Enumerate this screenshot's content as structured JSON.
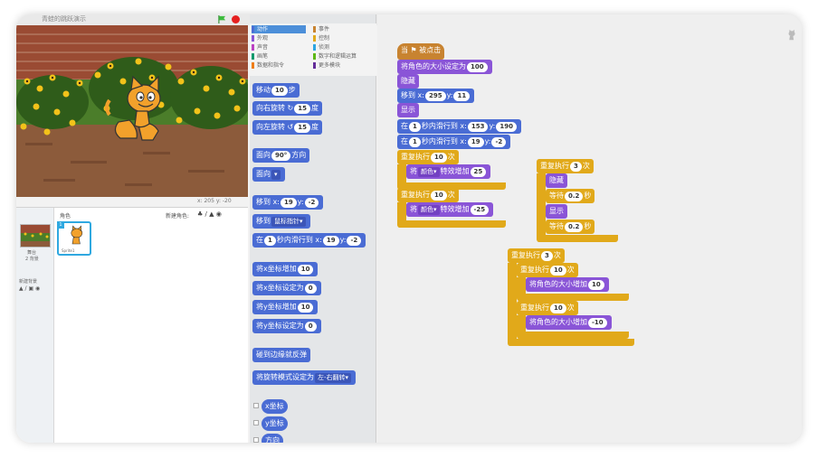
{
  "window": {
    "title": "青蛙的跳跃演示"
  },
  "stage": {
    "coords": "x: 205  y: -20"
  },
  "sprites": {
    "header": "角色",
    "new_sprite_label": "新建角色:",
    "stage_label": "舞台",
    "stage_count": "2 背景",
    "new_backdrop_label": "新建背景",
    "list": [
      {
        "index": "1",
        "name": "Sprite1"
      }
    ]
  },
  "categories": [
    {
      "label": "动作",
      "color": "#4a6cd4",
      "selected": true
    },
    {
      "label": "外观",
      "color": "#8a55d7"
    },
    {
      "label": "声音",
      "color": "#bb42c3"
    },
    {
      "label": "画笔",
      "color": "#0e9a6c"
    },
    {
      "label": "数据和指令",
      "color": "#ee7d16"
    },
    {
      "label": "事件",
      "color": "#c88330"
    },
    {
      "label": "控制",
      "color": "#e1a91a"
    },
    {
      "label": "侦测",
      "color": "#2ca5e2"
    },
    {
      "label": "数字和逻辑运算",
      "color": "#5cb712"
    },
    {
      "label": "更多模块",
      "color": "#632d99"
    }
  ],
  "palette": {
    "move": {
      "pre": "移动",
      "v": "10",
      "post": "步"
    },
    "turn_right": {
      "pre": "向右旋转",
      "icon": "↻",
      "v": "15",
      "post": "度"
    },
    "turn_left": {
      "pre": "向左旋转",
      "icon": "↺",
      "v": "15",
      "post": "度"
    },
    "point_dir": {
      "pre": "面向",
      "v": "90°",
      "post": "方向"
    },
    "point_towards": {
      "pre": "面向",
      "v": "▾"
    },
    "goto_xy": {
      "pre": "移到 x:",
      "x": "19",
      "mid": "y:",
      "y": "-2"
    },
    "goto_target": {
      "pre": "移到",
      "v": "鼠标指针▾"
    },
    "glide": {
      "pre": "在",
      "secs": "1",
      "mid": "秒内滑行到 x:",
      "x": "19",
      "mid2": "y:",
      "y": "-2"
    },
    "change_x": {
      "pre": "将x坐标增加",
      "v": "10"
    },
    "set_x": {
      "pre": "将x坐标设定为",
      "v": "0"
    },
    "change_y": {
      "pre": "将y坐标增加",
      "v": "10"
    },
    "set_y": {
      "pre": "将y坐标设定为",
      "v": "0"
    },
    "bounce": {
      "label": "碰到边缘就反弹"
    },
    "rotation_style": {
      "pre": "将旋转模式设定为",
      "v": "左-右翻转▾"
    },
    "reporters": [
      "x坐标",
      "y坐标",
      "方向"
    ]
  },
  "script": {
    "hat": "当 ⚑ 被点击",
    "set_size": {
      "pre": "将角色的大小设定为",
      "v": "100"
    },
    "hide": "隐藏",
    "goto": {
      "pre": "移到 x:",
      "x": "295",
      "mid": "y:",
      "y": "11"
    },
    "show": "显示",
    "glide1": {
      "pre": "在",
      "s": "1",
      "mid": "秒内滑行到 x:",
      "x": "153",
      "mid2": "y:",
      "y": "190"
    },
    "glide2": {
      "pre": "在",
      "s": "1",
      "mid": "秒内滑行到 x:",
      "x": "19",
      "mid2": "y:",
      "y": "-2"
    },
    "repeat1": {
      "pre": "重复执行",
      "v": "10",
      "post": "次"
    },
    "effect1": {
      "pre": "将",
      "effect": "颜色▾",
      "mid": "特效增加",
      "v": "25"
    },
    "repeat2": {
      "pre": "重复执行",
      "v": "10",
      "post": "次"
    },
    "effect2": {
      "pre": "将",
      "effect": "颜色▾",
      "mid": "特效增加",
      "v": "-25"
    },
    "stack2": {
      "repeat": {
        "pre": "重复执行",
        "v": "3",
        "post": "次"
      },
      "hide": "隐藏",
      "wait1": {
        "pre": "等待",
        "v": "0.2",
        "post": "秒"
      },
      "show": "显示",
      "wait2": {
        "pre": "等待",
        "v": "0.2",
        "post": "秒"
      }
    },
    "stack3": {
      "repeat": {
        "pre": "重复执行",
        "v": "3",
        "post": "次"
      },
      "inner1": {
        "pre": "重复执行",
        "v": "10",
        "post": "次"
      },
      "grow": {
        "pre": "将角色的大小增加",
        "v": "10"
      },
      "inner2": {
        "pre": "重复执行",
        "v": "10",
        "post": "次"
      },
      "shrink": {
        "pre": "将角色的大小增加",
        "v": "-10"
      }
    }
  },
  "watermark": "Sprite1\nx: 205"
}
